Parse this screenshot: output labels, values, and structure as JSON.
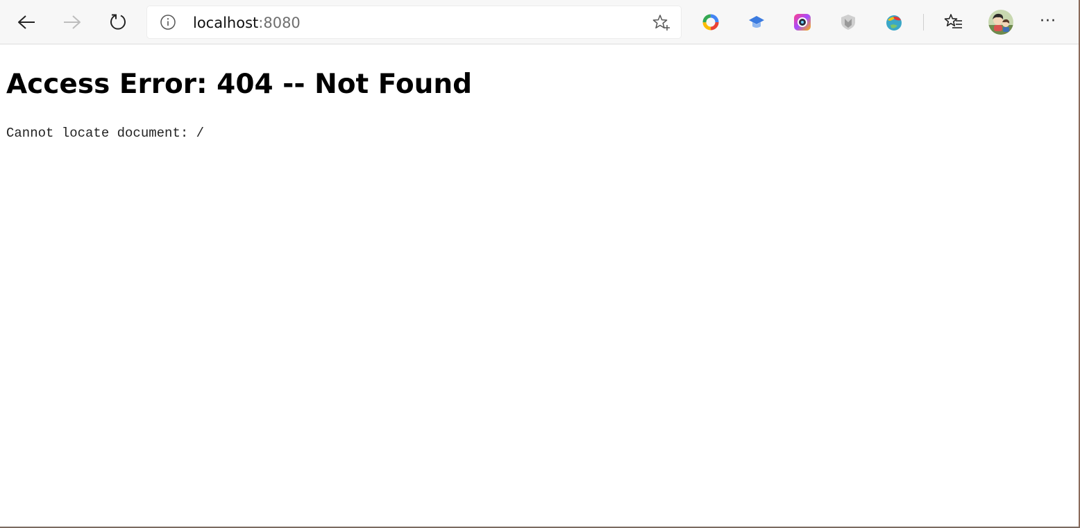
{
  "browser": {
    "address_bar": {
      "host": "localhost",
      "port": ":8080",
      "site_info_icon": "info-icon",
      "favorite_icon": "star-add-icon"
    },
    "nav": {
      "back_icon": "arrow-left-icon",
      "forward_icon": "arrow-right-icon",
      "refresh_icon": "refresh-icon"
    },
    "extensions": [
      {
        "icon": "ring-extension-icon"
      },
      {
        "icon": "graduation-cap-extension-icon"
      },
      {
        "icon": "camera-extension-icon"
      },
      {
        "icon": "shield-extension-icon"
      },
      {
        "icon": "globe-extension-icon"
      }
    ],
    "favorites_icon": "favorites-list-icon",
    "profile_icon": "profile-avatar",
    "more_label": "···"
  },
  "page": {
    "title": "Access Error: 404 -- Not Found",
    "message": "Cannot locate document: /"
  },
  "colors": {
    "toolbar_bg": "#f7f7f7",
    "page_bg": "#ffffff",
    "text": "#000000"
  }
}
